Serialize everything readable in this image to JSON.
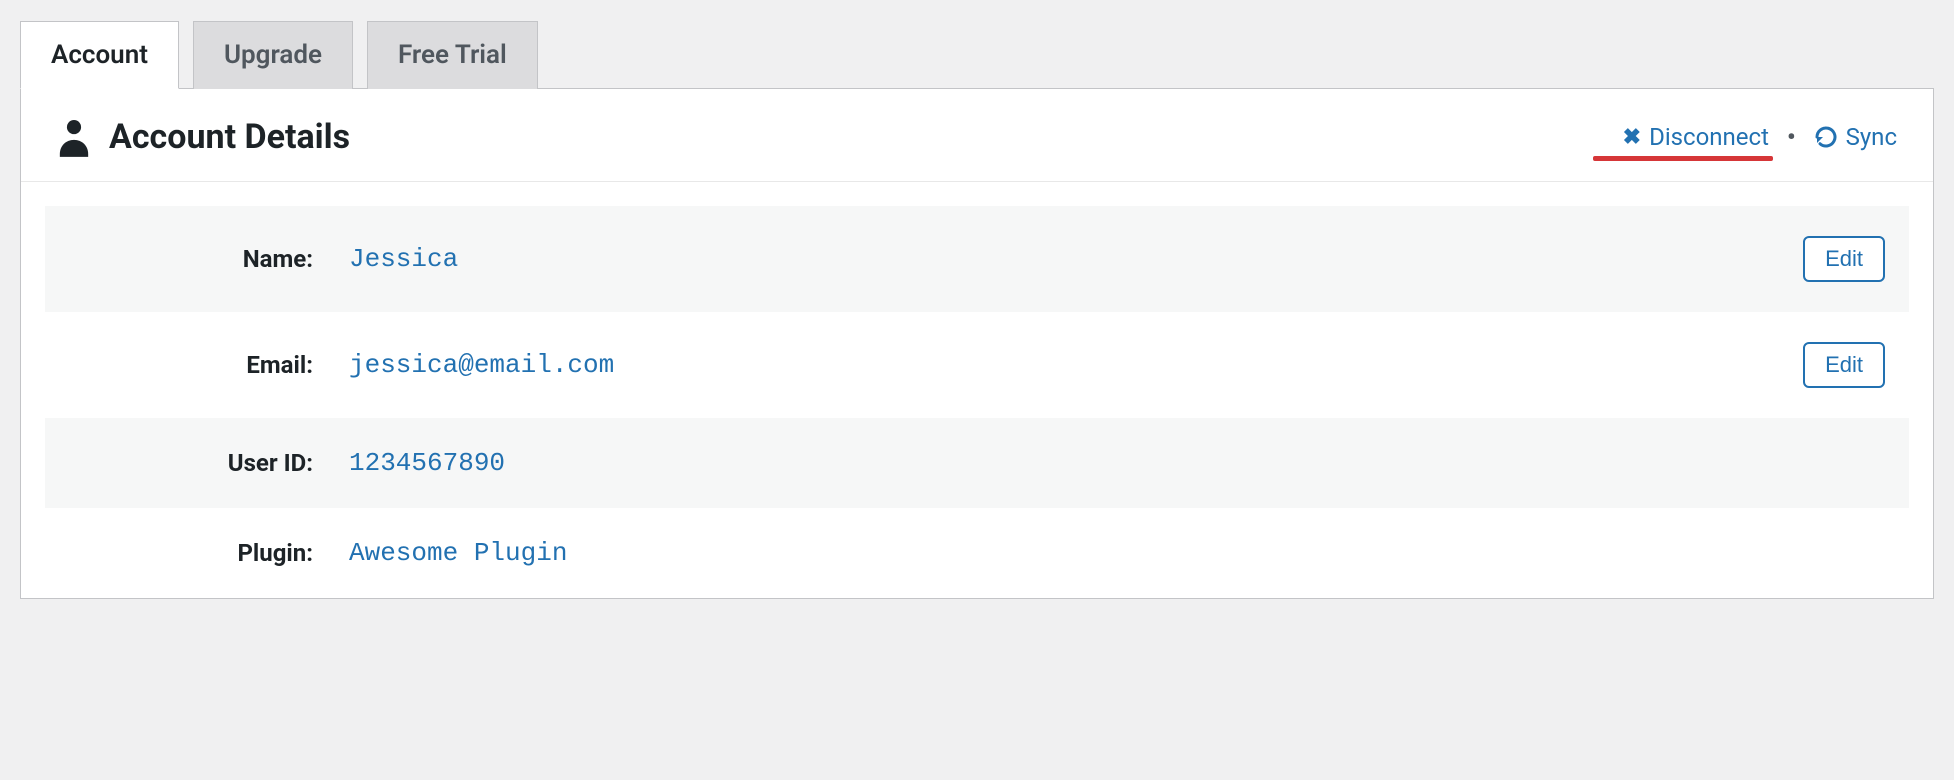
{
  "tabs": [
    {
      "label": "Account",
      "active": true
    },
    {
      "label": "Upgrade",
      "active": false
    },
    {
      "label": "Free Trial",
      "active": false
    }
  ],
  "header": {
    "title": "Account Details",
    "disconnect_label": "Disconnect",
    "sync_label": "Sync"
  },
  "details": {
    "name": {
      "label": "Name:",
      "value": "Jessica",
      "edit_label": "Edit"
    },
    "email": {
      "label": "Email:",
      "value": "jessica@email.com",
      "edit_label": "Edit"
    },
    "user_id": {
      "label": "User ID:",
      "value": "1234567890"
    },
    "plugin": {
      "label": "Plugin:",
      "value": "Awesome Plugin"
    }
  },
  "colors": {
    "link": "#2271b1",
    "highlight": "#d63638",
    "panel_bg": "#ffffff",
    "page_bg": "#f0f0f1"
  }
}
